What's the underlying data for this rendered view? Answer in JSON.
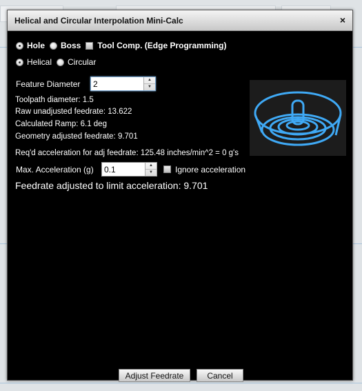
{
  "dialog": {
    "title": "Helical and Circular Interpolation Mini-Calc",
    "close_symbol": "×"
  },
  "feature_type": {
    "hole_label": "Hole",
    "hole_checked": true,
    "boss_label": "Boss",
    "boss_checked": false,
    "tool_comp_label": "Tool Comp. (Edge Programming)",
    "tool_comp_checked": false
  },
  "interpolation": {
    "helical_label": "Helical",
    "helical_checked": true,
    "circular_label": "Circular",
    "circular_checked": false
  },
  "feature_diameter": {
    "label": "Feature Diameter",
    "value": "2"
  },
  "results": {
    "toolpath_diameter": "Toolpath diameter: 1.5",
    "raw_feedrate": "Raw unadjusted feedrate: 13.622",
    "calculated_ramp": "Calculated Ramp: 6.1 deg",
    "geometry_feedrate": "Geometry adjusted feedrate: 9.701",
    "required_accel": "Req'd acceleration for adj feedrate: 125.48 inches/min^2 = 0 g's"
  },
  "max_acceleration": {
    "label": "Max. Acceleration (g)",
    "value": "0.1",
    "ignore_label": "Ignore acceleration",
    "ignore_checked": false
  },
  "final_feedrate": "Feedrate adjusted to limit acceleration: 9.701",
  "preview": {
    "icon": "helical-toolpath-preview",
    "color": "#3fa9f5"
  },
  "buttons": {
    "adjust_label": "Adjust Feedrate",
    "cancel_label": "Cancel"
  }
}
